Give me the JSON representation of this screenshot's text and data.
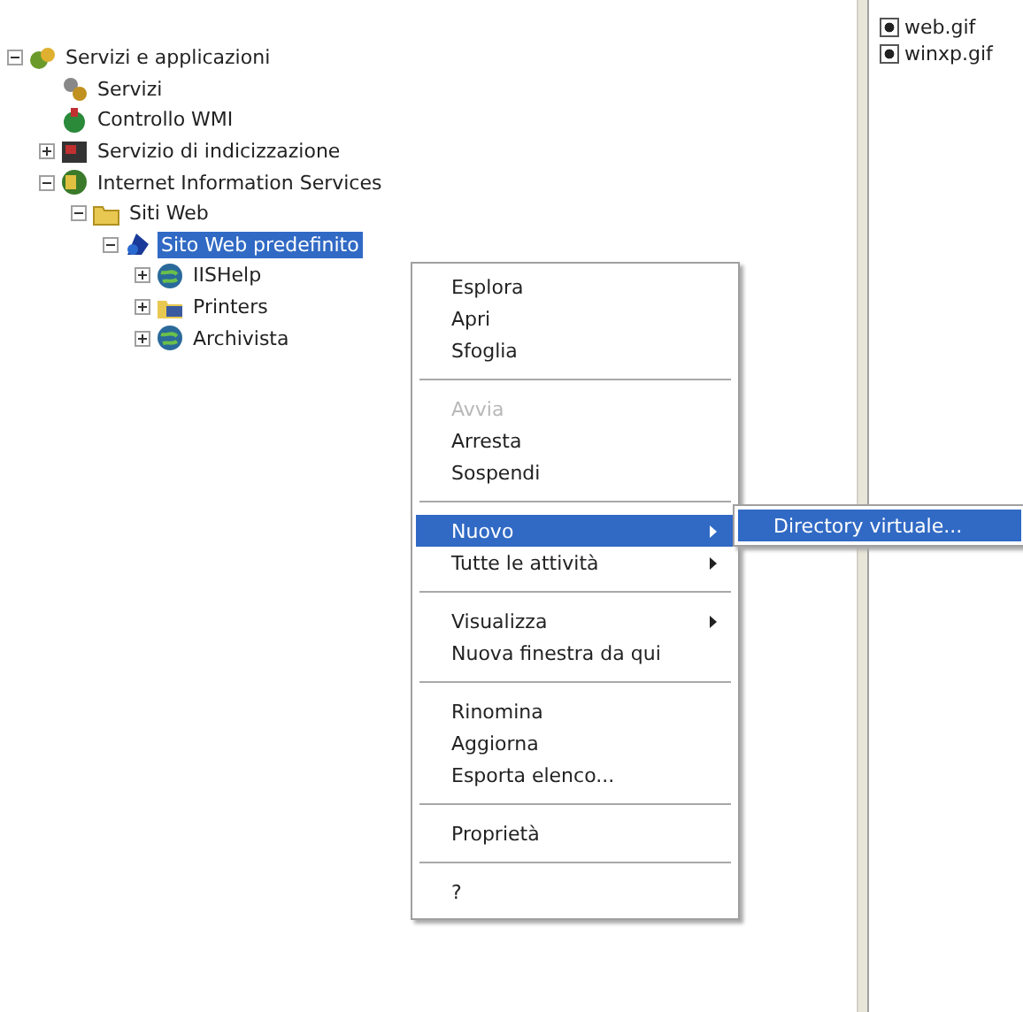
{
  "tree": [
    {
      "label": "Servizi e applicazioni",
      "kind": "services",
      "expanded": true,
      "selected": false,
      "children": [
        {
          "label": "Servizi",
          "kind": "gears",
          "selected": false
        },
        {
          "label": "Controllo WMI",
          "kind": "wmi",
          "selected": false
        },
        {
          "label": "Servizio di indicizzazione",
          "kind": "index",
          "expanded": false,
          "selected": false
        },
        {
          "label": "Internet Information Services",
          "kind": "iis",
          "expanded": true,
          "selected": false,
          "children": [
            {
              "label": "Siti Web",
              "kind": "folder",
              "expanded": true,
              "selected": false,
              "children": [
                {
                  "label": "Sito Web predefinito",
                  "kind": "site",
                  "expanded": true,
                  "selected": true,
                  "children": [
                    {
                      "label": "IISHelp",
                      "kind": "globe",
                      "expanded": false,
                      "selected": false
                    },
                    {
                      "label": "Printers",
                      "kind": "printer",
                      "expanded": false,
                      "selected": false
                    },
                    {
                      "label": "Archivista",
                      "kind": "globe",
                      "expanded": false,
                      "selected": false
                    }
                  ]
                }
              ]
            }
          ]
        }
      ]
    }
  ],
  "files": [
    {
      "label": "web.gif"
    },
    {
      "label": "winxp.gif"
    }
  ],
  "menu": [
    {
      "kind": "item",
      "label": "Esplora",
      "disabled": false,
      "submenu": false,
      "selected": false
    },
    {
      "kind": "item",
      "label": "Apri",
      "disabled": false,
      "submenu": false,
      "selected": false
    },
    {
      "kind": "item",
      "label": "Sfoglia",
      "disabled": false,
      "submenu": false,
      "selected": false
    },
    {
      "kind": "separator"
    },
    {
      "kind": "item",
      "label": "Avvia",
      "disabled": true,
      "submenu": false,
      "selected": false
    },
    {
      "kind": "item",
      "label": "Arresta",
      "disabled": false,
      "submenu": false,
      "selected": false
    },
    {
      "kind": "item",
      "label": "Sospendi",
      "disabled": false,
      "submenu": false,
      "selected": false
    },
    {
      "kind": "separator"
    },
    {
      "kind": "item",
      "label": "Nuovo",
      "disabled": false,
      "submenu": true,
      "selected": true
    },
    {
      "kind": "item",
      "label": "Tutte le attività",
      "disabled": false,
      "submenu": true,
      "selected": false
    },
    {
      "kind": "separator"
    },
    {
      "kind": "item",
      "label": "Visualizza",
      "disabled": false,
      "submenu": true,
      "selected": false
    },
    {
      "kind": "item",
      "label": "Nuova finestra da qui",
      "disabled": false,
      "submenu": false,
      "selected": false
    },
    {
      "kind": "separator"
    },
    {
      "kind": "item",
      "label": "Rinomina",
      "disabled": false,
      "submenu": false,
      "selected": false
    },
    {
      "kind": "item",
      "label": "Aggiorna",
      "disabled": false,
      "submenu": false,
      "selected": false
    },
    {
      "kind": "item",
      "label": "Esporta elenco...",
      "disabled": false,
      "submenu": false,
      "selected": false
    },
    {
      "kind": "separator"
    },
    {
      "kind": "item",
      "label": "Proprietà",
      "disabled": false,
      "submenu": false,
      "selected": false
    },
    {
      "kind": "separator"
    },
    {
      "kind": "item",
      "label": "?",
      "disabled": false,
      "submenu": false,
      "selected": false
    }
  ],
  "submenu": [
    {
      "label": "Directory virtuale...",
      "selected": true
    }
  ]
}
